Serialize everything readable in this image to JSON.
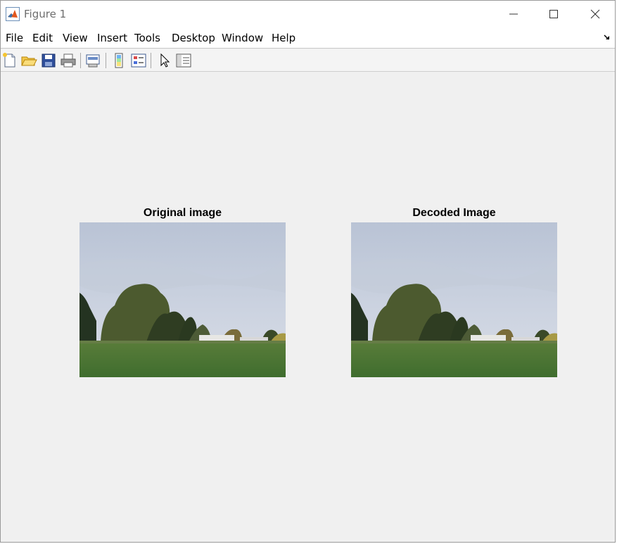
{
  "window": {
    "title": "Figure 1",
    "controls": {
      "minimize": "minimize",
      "maximize": "maximize",
      "close": "close"
    }
  },
  "menubar": {
    "items": [
      "File",
      "Edit",
      "View",
      "Insert",
      "Tools",
      "Desktop",
      "Window",
      "Help"
    ]
  },
  "toolbar": {
    "buttons": [
      {
        "icon": "new-figure-icon"
      },
      {
        "icon": "open-file-icon"
      },
      {
        "icon": "save-icon"
      },
      {
        "icon": "print-icon"
      },
      {
        "icon": "link-plot-icon"
      },
      {
        "icon": "insert-colorbar-icon"
      },
      {
        "icon": "insert-legend-icon"
      },
      {
        "icon": "edit-plot-arrow-icon"
      },
      {
        "icon": "property-inspector-icon"
      }
    ]
  },
  "axes": [
    {
      "title": "Original image"
    },
    {
      "title": "Decoded Image"
    }
  ],
  "colors": {
    "sky": "#c9d1df",
    "grass": "#4d7a34",
    "trees": "#3e4a2a"
  }
}
